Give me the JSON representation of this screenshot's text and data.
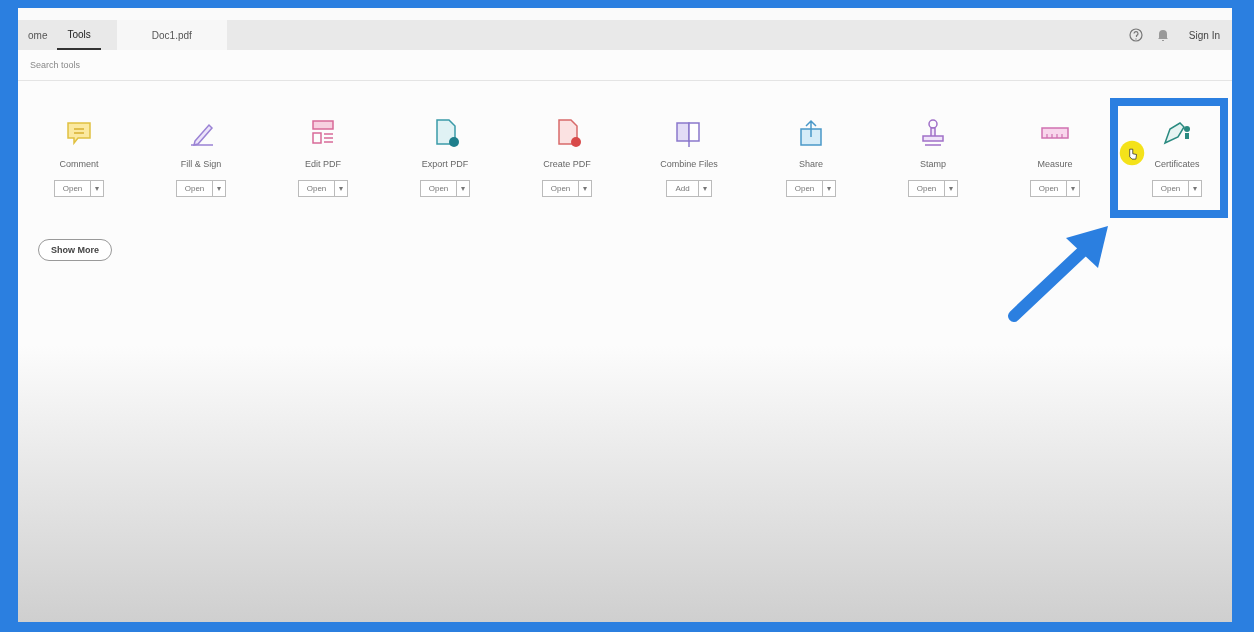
{
  "tabs": [
    {
      "label": "ome",
      "selected": false
    },
    {
      "label": "Tools",
      "selected": true
    }
  ],
  "document_tab": {
    "label": "Doc1.pdf"
  },
  "header": {
    "sign_in": "Sign In"
  },
  "search": {
    "placeholder": "Search tools"
  },
  "tools": [
    {
      "name": "Comment",
      "action": "Open",
      "caret": "▾"
    },
    {
      "name": "Fill & Sign",
      "action": "Open",
      "caret": "▾"
    },
    {
      "name": "Edit PDF",
      "action": "Open",
      "caret": "▾"
    },
    {
      "name": "Export PDF",
      "action": "Open",
      "caret": "▾"
    },
    {
      "name": "Create PDF",
      "action": "Open",
      "caret": "▾"
    },
    {
      "name": "Combine Files",
      "action": "Add",
      "caret": "▾"
    },
    {
      "name": "Share",
      "action": "Open",
      "caret": "▾"
    },
    {
      "name": "Stamp",
      "action": "Open",
      "caret": "▾"
    },
    {
      "name": "Measure",
      "action": "Open",
      "caret": "▾"
    },
    {
      "name": "Certificates",
      "action": "Open",
      "caret": "▾"
    }
  ],
  "show_more": {
    "label": "Show More"
  }
}
